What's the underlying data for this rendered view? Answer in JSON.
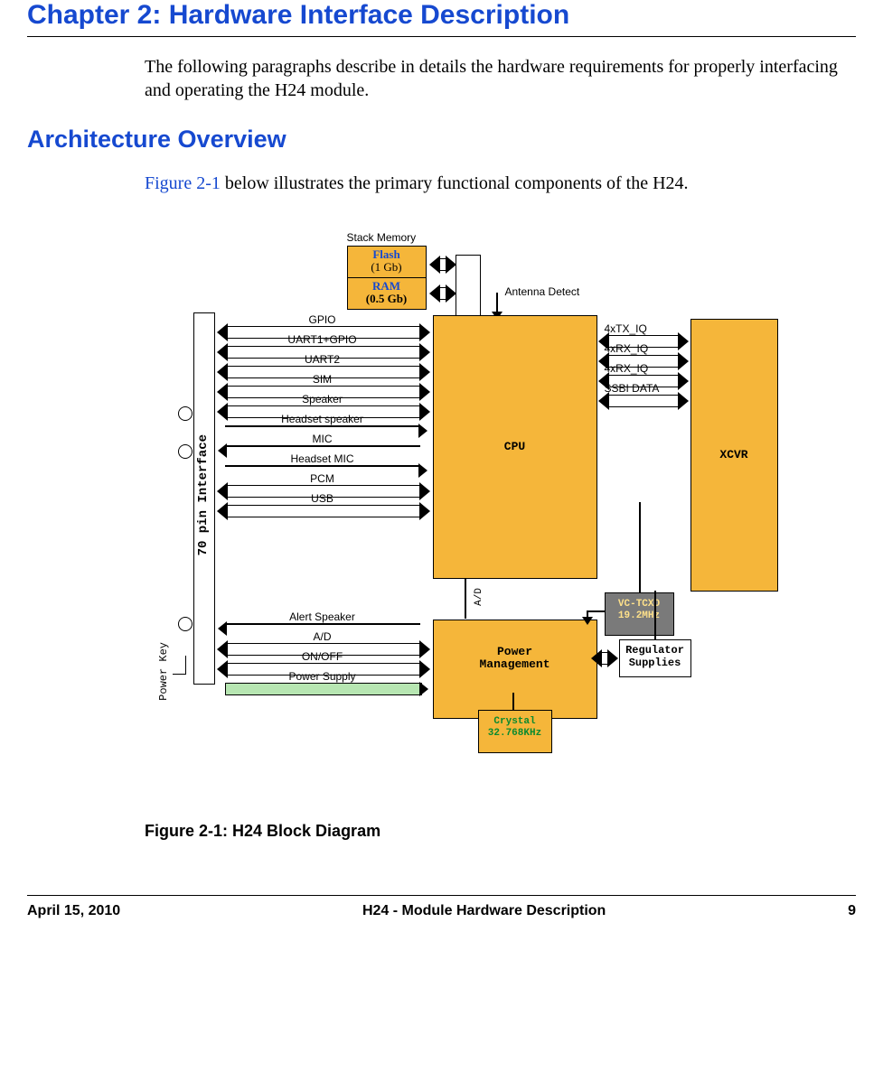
{
  "chapter_title": "Chapter 2: Hardware Interface Description",
  "intro": "The following paragraphs describe in details the hardware requirements for properly interfacing and operating the H24 module.",
  "section": {
    "title": "Architecture Overview",
    "xref": "Figure 2-1",
    "rest": " below illustrates the primary functional components of the H24."
  },
  "diagram": {
    "stack_memory": "Stack Memory",
    "flash": {
      "name": "Flash",
      "size": "(1 Gb)"
    },
    "ram": {
      "name": "RAM",
      "size": "(0.5 Gb)"
    },
    "antenna": "Antenna Detect",
    "cpu": "CPU",
    "xcvr": "XCVR",
    "pm": {
      "l1": "Power",
      "l2": "Management"
    },
    "tcxo": {
      "l1": "VC-TCXO",
      "l2": "19.2MHz"
    },
    "regulator": {
      "l1": "Regulator",
      "l2": "Supplies"
    },
    "crystal": {
      "l1": "Crystal",
      "l2": "32.768KHz"
    },
    "left_bus": [
      "GPIO",
      "UART1+GPIO",
      "UART2",
      "SIM",
      "Speaker",
      "Headset speaker",
      "MIC",
      "Headset MIC",
      "PCM",
      "USB"
    ],
    "pm_bus": [
      "Alert Speaker",
      "A/D",
      "ON/OFF",
      "Power Supply"
    ],
    "right_bus": [
      "4xTX_IQ",
      "4xRX_IQ",
      "4xRX_IQ",
      "SSBI DATA"
    ],
    "vlabels": {
      "interface": "70 pin Interface",
      "powerkey": "Power Key",
      "ad": "A/D"
    }
  },
  "caption": "Figure 2-1: H24 Block Diagram",
  "footer": {
    "date": "April 15, 2010",
    "title": "H24 - Module Hardware Description",
    "page": "9"
  }
}
